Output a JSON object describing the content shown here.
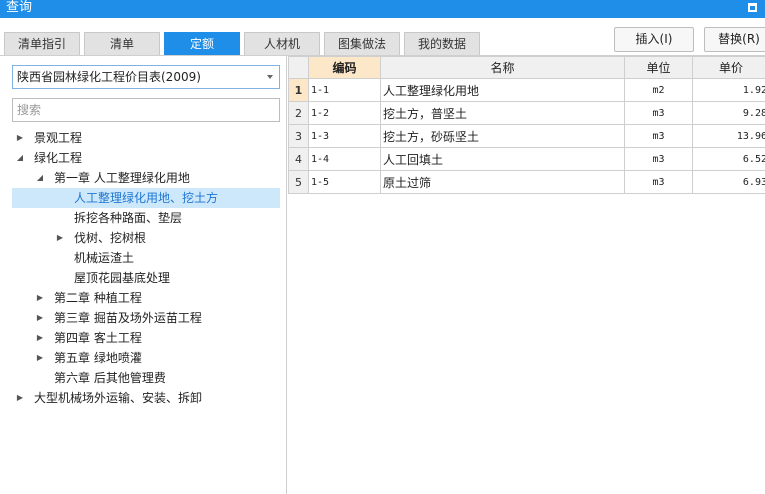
{
  "window": {
    "title": "查询"
  },
  "tabs": [
    "清单指引",
    "清单",
    "定额",
    "人材机",
    "图集做法",
    "我的数据"
  ],
  "active_tab": "定额",
  "buttons": {
    "insert": "插入(I)",
    "replace": "替换(R)"
  },
  "catalog_select": {
    "value": "陕西省园林绿化工程价目表(2009)"
  },
  "search": {
    "placeholder": "搜索"
  },
  "tree": [
    {
      "label": "景观工程",
      "toggle": "▶"
    },
    {
      "label": "绿化工程",
      "toggle": "◢"
    },
    {
      "label": "第一章 人工整理绿化用地",
      "toggle": "◢"
    },
    {
      "label": "人工整理绿化用地、挖土方",
      "toggle": ""
    },
    {
      "label": "拆挖各种路面、垫层",
      "toggle": ""
    },
    {
      "label": "伐树、挖树根",
      "toggle": "▶"
    },
    {
      "label": "机械运渣土",
      "toggle": ""
    },
    {
      "label": "屋顶花园基底处理",
      "toggle": ""
    },
    {
      "label": "第二章 种植工程",
      "toggle": "▶"
    },
    {
      "label": "第三章 掘苗及场外运苗工程",
      "toggle": "▶"
    },
    {
      "label": "第四章 客土工程",
      "toggle": "▶"
    },
    {
      "label": "第五章 绿地喷灌",
      "toggle": "▶"
    },
    {
      "label": "第六章 后其他管理费",
      "toggle": ""
    },
    {
      "label": "大型机械场外运输、安装、拆卸",
      "toggle": "▶"
    }
  ],
  "table": {
    "columns": [
      "编码",
      "名称",
      "单位",
      "单价"
    ],
    "rows": [
      {
        "no": "1",
        "code": "1-1",
        "name": "人工整理绿化用地",
        "unit": "m2",
        "price": "1.92"
      },
      {
        "no": "2",
        "code": "1-2",
        "name": "挖土方，普坚土",
        "unit": "m3",
        "price": "9.28"
      },
      {
        "no": "3",
        "code": "1-3",
        "name": "挖土方，砂砾坚土",
        "unit": "m3",
        "price": "13.96"
      },
      {
        "no": "4",
        "code": "1-4",
        "name": "人工回填土",
        "unit": "m3",
        "price": "6.52"
      },
      {
        "no": "5",
        "code": "1-5",
        "name": "原土过筛",
        "unit": "m3",
        "price": "6.93"
      }
    ]
  },
  "colors": {
    "accent": "#1e8ee8",
    "selection": "#cde8fb",
    "header_highlight": "#fde7c9"
  }
}
